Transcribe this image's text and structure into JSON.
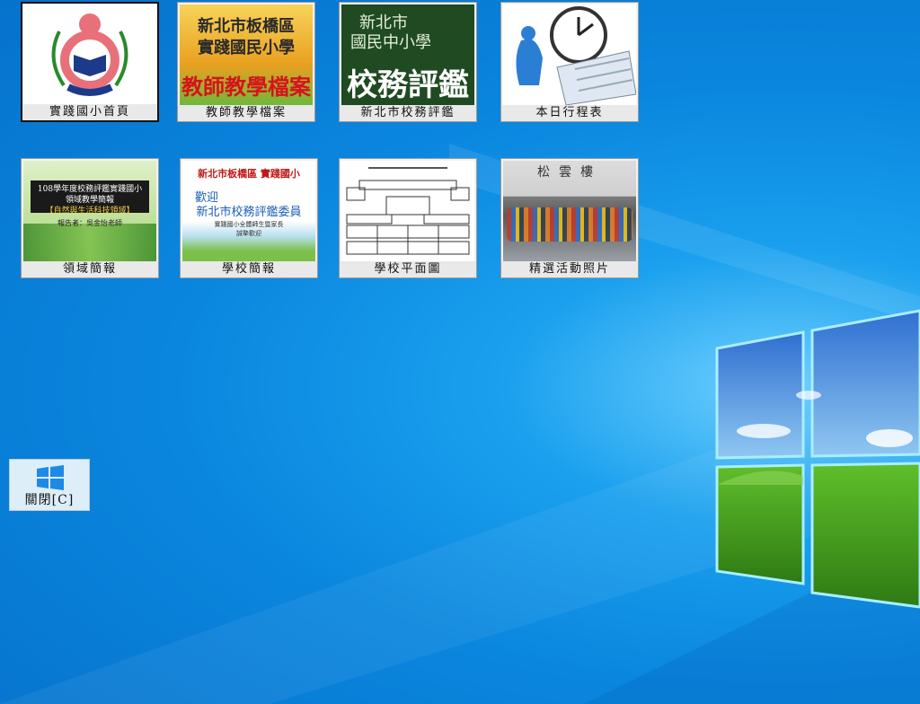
{
  "tiles": [
    {
      "label": "實踐國小首頁",
      "icon": "school-emblem-icon"
    },
    {
      "label": "教師教學檔案"
    },
    {
      "label": "新北市校務評鑑"
    },
    {
      "label": "本日行程表",
      "icon": "clock-schedule-icon"
    },
    {
      "label": "領域簡報"
    },
    {
      "label": "學校簡報"
    },
    {
      "label": "學校平面圖"
    },
    {
      "label": "精選活動照片"
    }
  ],
  "thumb_text": {
    "t2_line1": "新北市板橋區",
    "t2_line2": "實踐國民小學",
    "t2_line3": "教師教學檔案",
    "t3_line1": "新北市",
    "t3_line2": "國民中小學",
    "t3_line3": "校務評鑑",
    "t5_line1": "108學年度校務評鑑實踐國小",
    "t5_line2": "領域教學簡報",
    "t5_line3": "【自然與生活科技領域】",
    "t5_line4": "報告者：吳金怡老師",
    "t6_line1": "新北市板橋區 實踐國小",
    "t6_line2": "歡迎",
    "t6_line3": "新北市校務評鑑委員",
    "t6_line4": "實踐國小全體師生暨家長",
    "t6_line5": "誠摯歡迎",
    "t8_sign": "松雲樓"
  },
  "close_button": {
    "label": "關閉[C]",
    "icon": "windows-logo-icon"
  },
  "colors": {
    "desktop_blue": "#0a86de",
    "tile_bg": "#f2f2f2"
  }
}
